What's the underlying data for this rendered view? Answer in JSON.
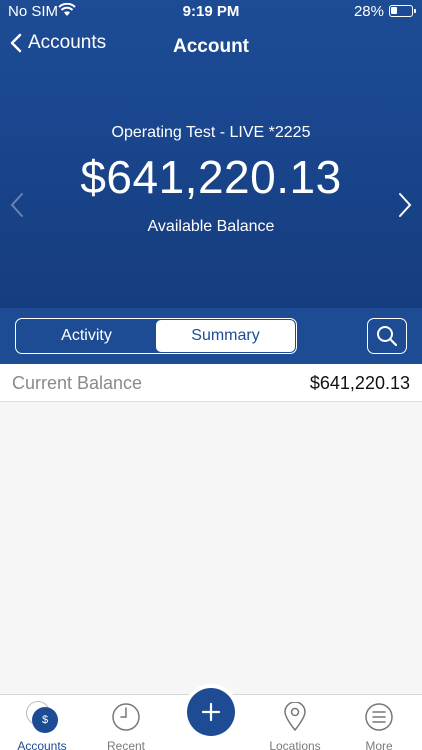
{
  "status_bar": {
    "carrier": "No SIM",
    "time": "9:19 PM",
    "battery": "28%"
  },
  "nav": {
    "back_label": "Accounts",
    "title": "Account"
  },
  "account": {
    "name": "Operating Test - LIVE *2225",
    "balance": "$641,220.13",
    "balance_label": "Available Balance"
  },
  "segments": {
    "activity": "Activity",
    "summary": "Summary",
    "selected": "Summary"
  },
  "summary_rows": [
    {
      "label": "Current Balance",
      "value": "$641,220.13"
    }
  ],
  "tabs": [
    {
      "label": "Accounts",
      "icon": "accounts-icon",
      "badge": "$"
    },
    {
      "label": "Recent",
      "icon": "clock-icon"
    },
    {
      "label": "Locations",
      "icon": "location-pin-icon"
    },
    {
      "label": "More",
      "icon": "menu-icon"
    }
  ],
  "colors": {
    "brand": "#1d4c95",
    "background": "#f6f6f6"
  }
}
